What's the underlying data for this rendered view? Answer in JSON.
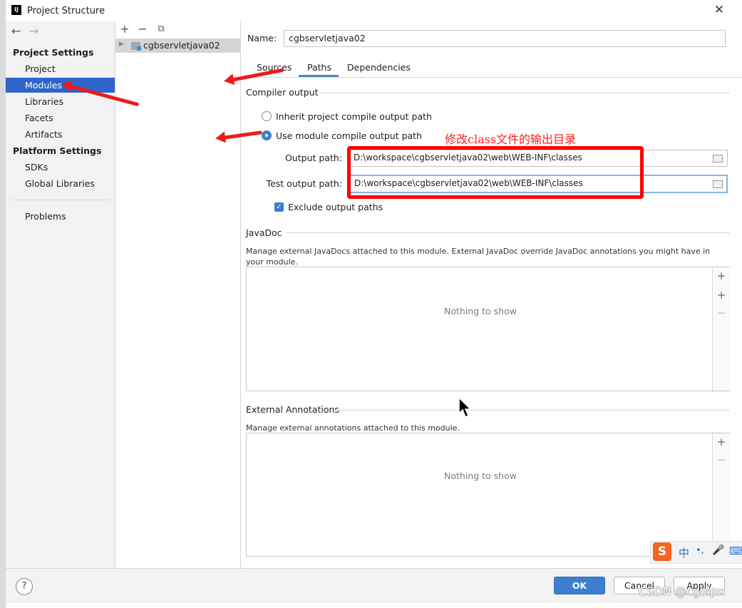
{
  "window": {
    "title": "Project Structure",
    "close_symbol": "✕",
    "logo_text": "IJ"
  },
  "nav": {
    "back_symbol": "←",
    "forward_symbol": "→",
    "project_settings_header": "Project Settings",
    "project_items": [
      "Project",
      "Modules",
      "Libraries",
      "Facets",
      "Artifacts"
    ],
    "platform_settings_header": "Platform Settings",
    "platform_items": [
      "SDKs",
      "Global Libraries"
    ],
    "problems": "Problems",
    "selected": "Modules"
  },
  "modules_toolbar": {
    "add": "+",
    "remove": "−",
    "copy": "⧉"
  },
  "module_tree": {
    "items": [
      "cgbservletjava02"
    ]
  },
  "name_field": {
    "label": "Name:",
    "value": "cgbservletjava02"
  },
  "tabs": {
    "items": [
      "Sources",
      "Paths",
      "Dependencies"
    ],
    "active": "Paths"
  },
  "compiler_output": {
    "title": "Compiler output",
    "inherit_option": "Inherit project compile output path",
    "module_option": "Use module compile output path",
    "selected_option": "Use module compile output path",
    "output_path_label": "Output path:",
    "output_path_value": "D:\\workspace\\cgbservletjava02\\web\\WEB-INF\\classes",
    "test_output_path_label": "Test output path:",
    "test_output_path_value": "D:\\workspace\\cgbservletjava02\\web\\WEB-INF\\classes",
    "exclude_label": "Exclude output paths",
    "exclude_checked": true
  },
  "javadoc": {
    "title": "JavaDoc",
    "description": "Manage external JavaDocs attached to this module. External JavaDoc override JavaDoc annotations you might have in your module.",
    "empty_text": "Nothing to show",
    "add": "+",
    "add_url": "+",
    "remove": "−"
  },
  "external_annotations": {
    "title": "External Annotations",
    "description": "Manage external annotations attached to this module.",
    "empty_text": "Nothing to show",
    "add": "+",
    "remove": "−"
  },
  "buttons": {
    "help": "?",
    "ok": "OK",
    "cancel": "Cancel",
    "apply": "Apply"
  },
  "annotation": {
    "text": "修改class文件的输出目录",
    "color": "#ff0000"
  },
  "watermark": "CSDN @cgblpx",
  "ime": {
    "logo": "S",
    "lang": "中",
    "punct": "•,",
    "mic": "🎤",
    "keyboard": "⌨"
  },
  "colors": {
    "selection": "#2f65ca",
    "accent": "#3d7ed0",
    "highlight": "#ff0000"
  }
}
